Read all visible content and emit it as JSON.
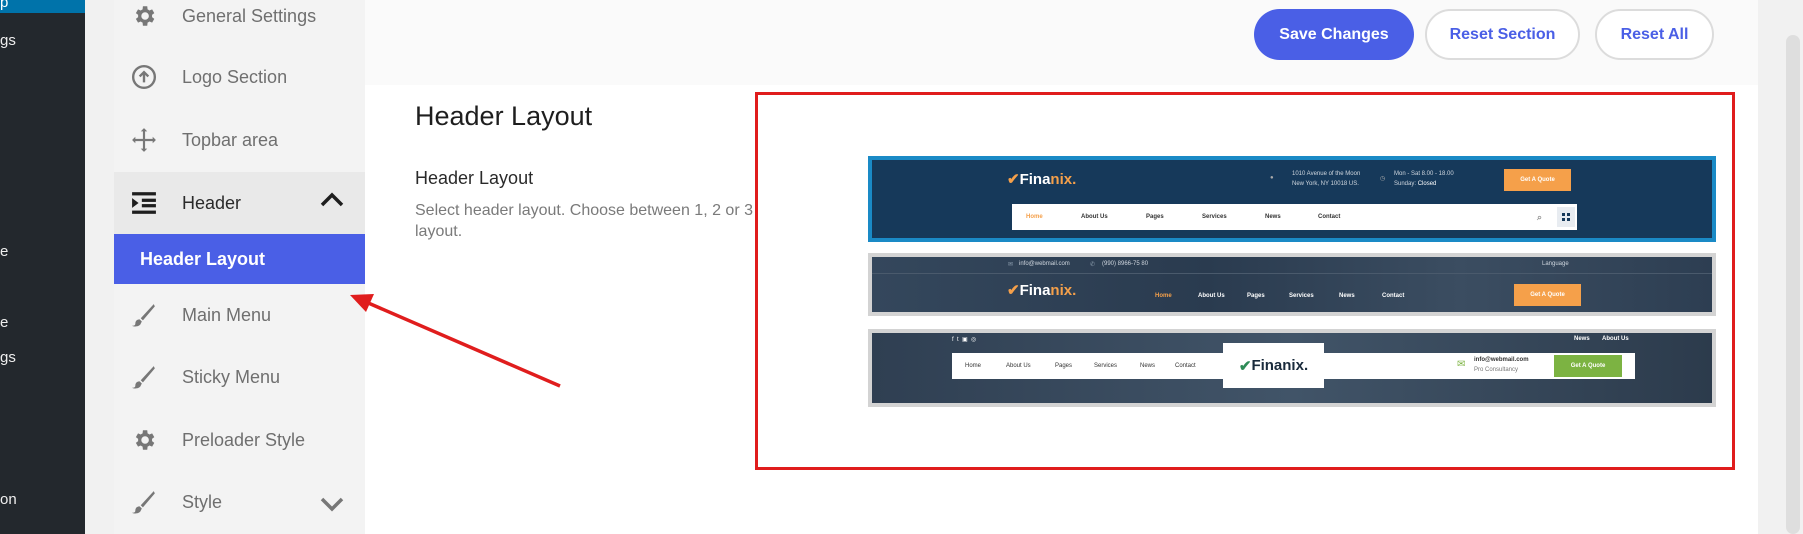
{
  "wp_admin": {
    "selected_fragment": "p",
    "fragments": [
      "gs",
      "e",
      "e",
      "gs",
      "on"
    ]
  },
  "options_nav": {
    "items": [
      {
        "label": "General Settings",
        "icon": "gear-icon"
      },
      {
        "label": "Logo Section",
        "icon": "arrow-up-circle-icon"
      },
      {
        "label": "Topbar area",
        "icon": "move-arrows-icon"
      },
      {
        "label": "Header",
        "icon": "indent-list-icon"
      },
      {
        "label": "Main Menu",
        "icon": "brush-icon"
      },
      {
        "label": "Sticky Menu",
        "icon": "brush-icon"
      },
      {
        "label": "Preloader Style",
        "icon": "gear-icon"
      },
      {
        "label": "Style",
        "icon": "brush-icon"
      }
    ],
    "active_sub": "Header Layout"
  },
  "toolbar": {
    "save_label": "Save Changes",
    "reset_section_label": "Reset Section",
    "reset_all_label": "Reset All"
  },
  "content": {
    "section_title": "Header Layout",
    "field_title": "Header Layout",
    "field_desc": "Select header layout. Choose between 1, 2 or 3 layout."
  },
  "previews": {
    "layout1": {
      "logo_main": "Fina",
      "logo_accent": "nix.",
      "address_line1": "1010 Avenue of the Moon",
      "address_line2": "New York, NY 10018 US.",
      "hours_line1": "Mon - Sat 8.00 - 18.00",
      "hours_line2_label": "Sunday:",
      "hours_line2_value": "Closed",
      "quote_button": "Get A Quote",
      "nav": [
        "Home",
        "About Us",
        "Pages",
        "Services",
        "News",
        "Contact"
      ]
    },
    "layout2": {
      "email": "info@webmail.com",
      "phone": "(990) 8966-75 80",
      "language": "Language",
      "logo_main": "Fina",
      "logo_accent": "nix.",
      "quote_button": "Get A Quote",
      "nav": [
        "Home",
        "About Us",
        "Pages",
        "Services",
        "News",
        "Contact"
      ]
    },
    "layout3": {
      "top_links": [
        "News",
        "About Us"
      ],
      "logo": "Finanix.",
      "email": "info@webmail.com",
      "tagline": "Pro Consultancy",
      "quote_button": "Get A Quote",
      "nav": [
        "Home",
        "About Us",
        "Pages",
        "Services",
        "News",
        "Contact"
      ]
    }
  },
  "colors": {
    "accent": "#4a5fe6",
    "highlight_border": "#e01d1d",
    "annotation_arrow": "#e01d1d"
  }
}
